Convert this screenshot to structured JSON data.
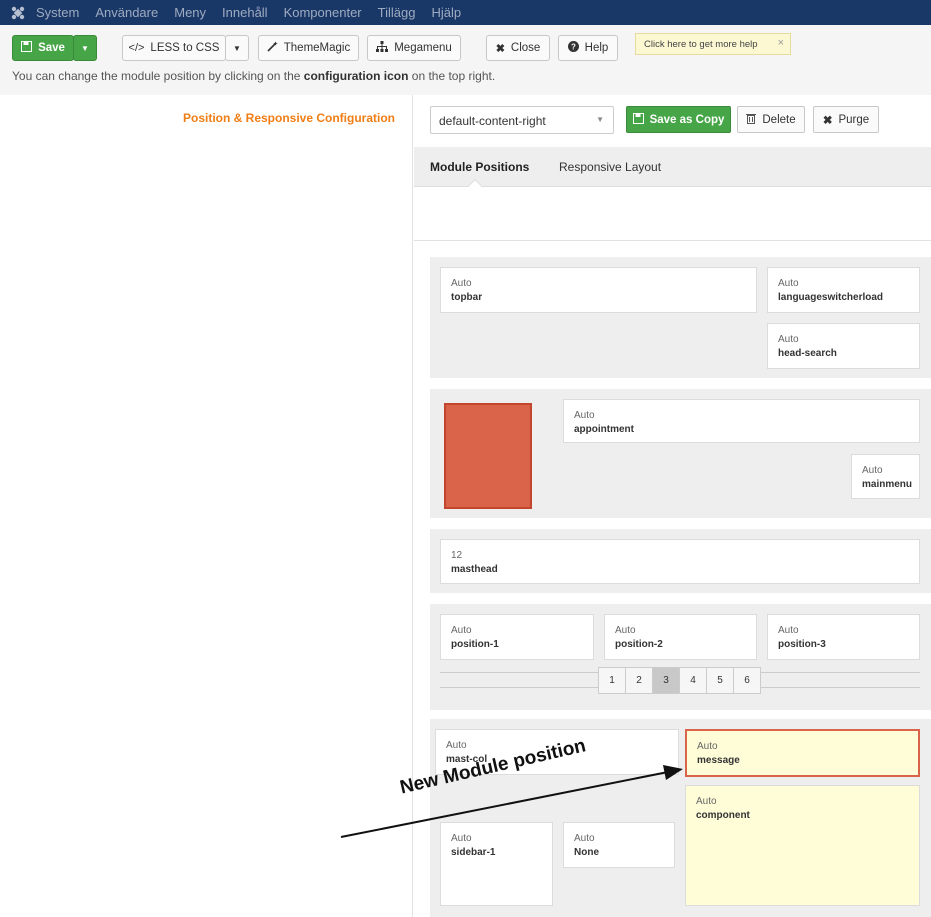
{
  "topnav": {
    "items": [
      "System",
      "Användare",
      "Meny",
      "Innehåll",
      "Komponenter",
      "Tillägg",
      "Hjälp"
    ]
  },
  "toolbar": {
    "save_label": "Save",
    "less_label": "LESS to CSS",
    "thememagic_label": "ThemeMagic",
    "megamenu_label": "Megamenu",
    "close_label": "Close",
    "help_label": "Help",
    "tooltip": "Click here to get more help",
    "tooltip_close": "×"
  },
  "info": {
    "before": "You can change the module position by clicking on the ",
    "bold": "configuration icon",
    "after": " on the top right."
  },
  "left": {
    "section_title": "Position & Responsive Configuration"
  },
  "right": {
    "layout_select": "default-content-right",
    "save_copy_label": "Save as Copy",
    "delete_label": "Delete",
    "purge_label": "Purge",
    "tabs": [
      "Module Positions",
      "Responsive Layout"
    ]
  },
  "rows": {
    "row1": [
      {
        "width": "Auto",
        "name": "topbar"
      },
      {
        "width": "Auto",
        "name": "languageswitcherload"
      },
      {
        "width": "Auto",
        "name": "head-search"
      }
    ],
    "row2": [
      {
        "width": "Auto",
        "name": "appointment"
      },
      {
        "width": "Auto",
        "name": "mainmenu"
      }
    ],
    "row3": [
      {
        "width": "12",
        "name": "masthead"
      }
    ],
    "row4": [
      {
        "width": "Auto",
        "name": "position-1"
      },
      {
        "width": "Auto",
        "name": "position-2"
      },
      {
        "width": "Auto",
        "name": "position-3"
      }
    ],
    "pager": [
      "1",
      "2",
      "3",
      "4",
      "5",
      "6"
    ],
    "pager_active": "3",
    "row5": [
      {
        "width": "Auto",
        "name": "mast-col"
      },
      {
        "width": "Auto",
        "name": "message"
      },
      {
        "width": "Auto",
        "name": "component"
      },
      {
        "width": "Auto",
        "name": "sidebar-1"
      },
      {
        "width": "Auto",
        "name": "None"
      }
    ]
  },
  "annotation": {
    "text": "New Module position"
  },
  "colors": {
    "nav_bg": "#1a3867",
    "green": "#46a546",
    "orange_title": "#f07e16",
    "highlight_border": "#d9644a",
    "yellow_bg": "#fefdd8"
  }
}
